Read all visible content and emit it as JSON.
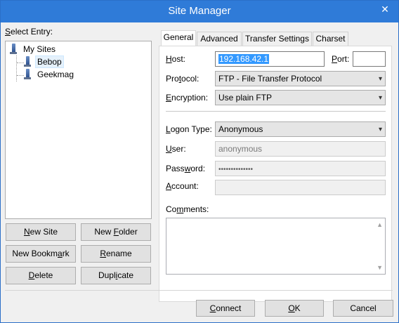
{
  "window": {
    "title": "Site Manager",
    "close_glyph": "✕"
  },
  "left": {
    "select_entry_label_pre": "",
    "select_entry_label_u": "S",
    "select_entry_label_post": "elect Entry:",
    "tree": {
      "root": "My Sites",
      "children": [
        "Bebop",
        "Geekmag"
      ],
      "selected": "Bebop"
    },
    "buttons": {
      "new_site": {
        "pre": "",
        "u": "N",
        "post": "ew Site"
      },
      "new_folder": {
        "pre": "New ",
        "u": "F",
        "post": "older"
      },
      "new_bookmark": {
        "pre": "New Bookm",
        "u": "a",
        "post": "rk"
      },
      "rename": {
        "pre": "",
        "u": "R",
        "post": "ename"
      },
      "delete": {
        "pre": "",
        "u": "D",
        "post": "elete"
      },
      "duplicate": {
        "pre": "Dupl",
        "u": "i",
        "post": "cate"
      }
    }
  },
  "tabs": [
    "General",
    "Advanced",
    "Transfer Settings",
    "Charset"
  ],
  "active_tab": "General",
  "general": {
    "host_label": {
      "pre": "",
      "u": "H",
      "post": "ost:"
    },
    "host_value": "192.168.42.1",
    "port_label": {
      "pre": "",
      "u": "P",
      "post": "ort:"
    },
    "port_value": "",
    "protocol_label": {
      "pre": "Pro",
      "u": "t",
      "post": "ocol:"
    },
    "protocol_value": "FTP - File Transfer Protocol",
    "encryption_label": {
      "pre": "",
      "u": "E",
      "post": "ncryption:"
    },
    "encryption_value": "Use plain FTP",
    "logon_type_label": {
      "pre": "",
      "u": "L",
      "post": "ogon Type:"
    },
    "logon_type_value": "Anonymous",
    "user_label": {
      "pre": "",
      "u": "U",
      "post": "ser:"
    },
    "user_value": "anonymous",
    "password_label": {
      "pre": "Pass",
      "u": "w",
      "post": "ord:"
    },
    "password_value": "••••••••••••••",
    "account_label": {
      "pre": "",
      "u": "A",
      "post": "ccount:"
    },
    "account_value": "",
    "comments_label": {
      "pre": "Co",
      "u": "m",
      "post": "ments:"
    }
  },
  "footer": {
    "connect": {
      "pre": "",
      "u": "C",
      "post": "onnect"
    },
    "ok": {
      "pre": "",
      "u": "O",
      "post": "K"
    },
    "cancel": "Cancel"
  },
  "icons": {
    "dropdown": "chevron-down-icon",
    "scroll_up": "scroll-up-arrow-icon",
    "scroll_down": "scroll-down-arrow-icon"
  }
}
